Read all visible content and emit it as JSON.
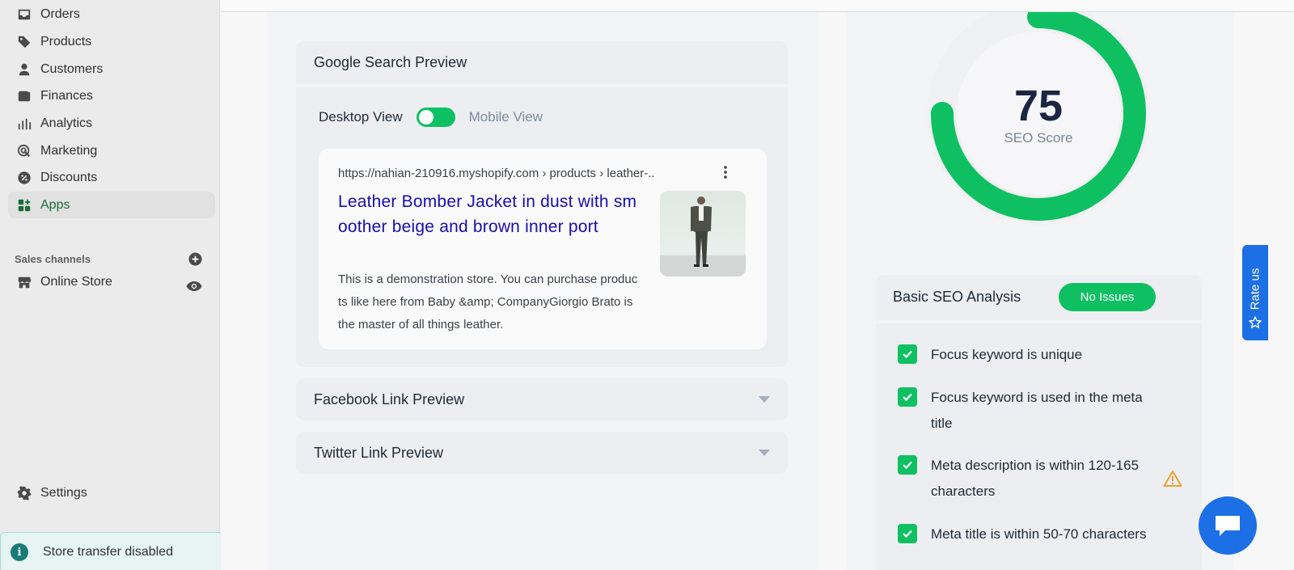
{
  "sidebar": {
    "items": [
      {
        "label": "Orders",
        "icon": "orders-icon"
      },
      {
        "label": "Products",
        "icon": "tag-icon"
      },
      {
        "label": "Customers",
        "icon": "person-icon"
      },
      {
        "label": "Finances",
        "icon": "wallet-icon"
      },
      {
        "label": "Analytics",
        "icon": "bar-chart-icon"
      },
      {
        "label": "Marketing",
        "icon": "target-icon"
      },
      {
        "label": "Discounts",
        "icon": "discount-icon"
      },
      {
        "label": "Apps",
        "icon": "apps-icon",
        "active": true
      }
    ],
    "sales_channels_label": "Sales channels",
    "online_store_label": "Online Store",
    "settings_label": "Settings",
    "notice_text": "Store transfer disabled",
    "active_color": "#1a6b3a"
  },
  "google_preview": {
    "title": "Google Search Preview",
    "desktop_label": "Desktop View",
    "mobile_label": "Mobile View",
    "serp_url": "https://nahian-210916.myshopify.com › products › leather-..",
    "serp_title": "Leather Bomber Jacket in dust with smoother beige and brown inner port",
    "serp_description": "This is a demonstration store. You can purchase products like here from Baby &amp; CompanyGiorgio Brato is the master of all things leather."
  },
  "facebook_preview": {
    "title": "Facebook Link Preview"
  },
  "twitter_preview": {
    "title": "Twitter Link Preview"
  },
  "seo_score": {
    "value": "75",
    "label": "SEO Score",
    "fraction": 0.75,
    "color": "#0ec062"
  },
  "basic_seo": {
    "title": "Basic SEO Analysis",
    "badge": "No Issues",
    "checks": [
      {
        "text": "Focus keyword is unique"
      },
      {
        "text": "Focus keyword is used in the meta title"
      },
      {
        "text": "Meta description is within 120-165 characters",
        "warning": true
      },
      {
        "text": "Meta title is within 50-70 characters"
      }
    ]
  },
  "rate_us": "Rate us",
  "colors": {
    "accent_green": "#0ec062",
    "link_blue": "#1a0dab",
    "brand_blue": "#1d6fe6",
    "warning": "#f0a030"
  }
}
